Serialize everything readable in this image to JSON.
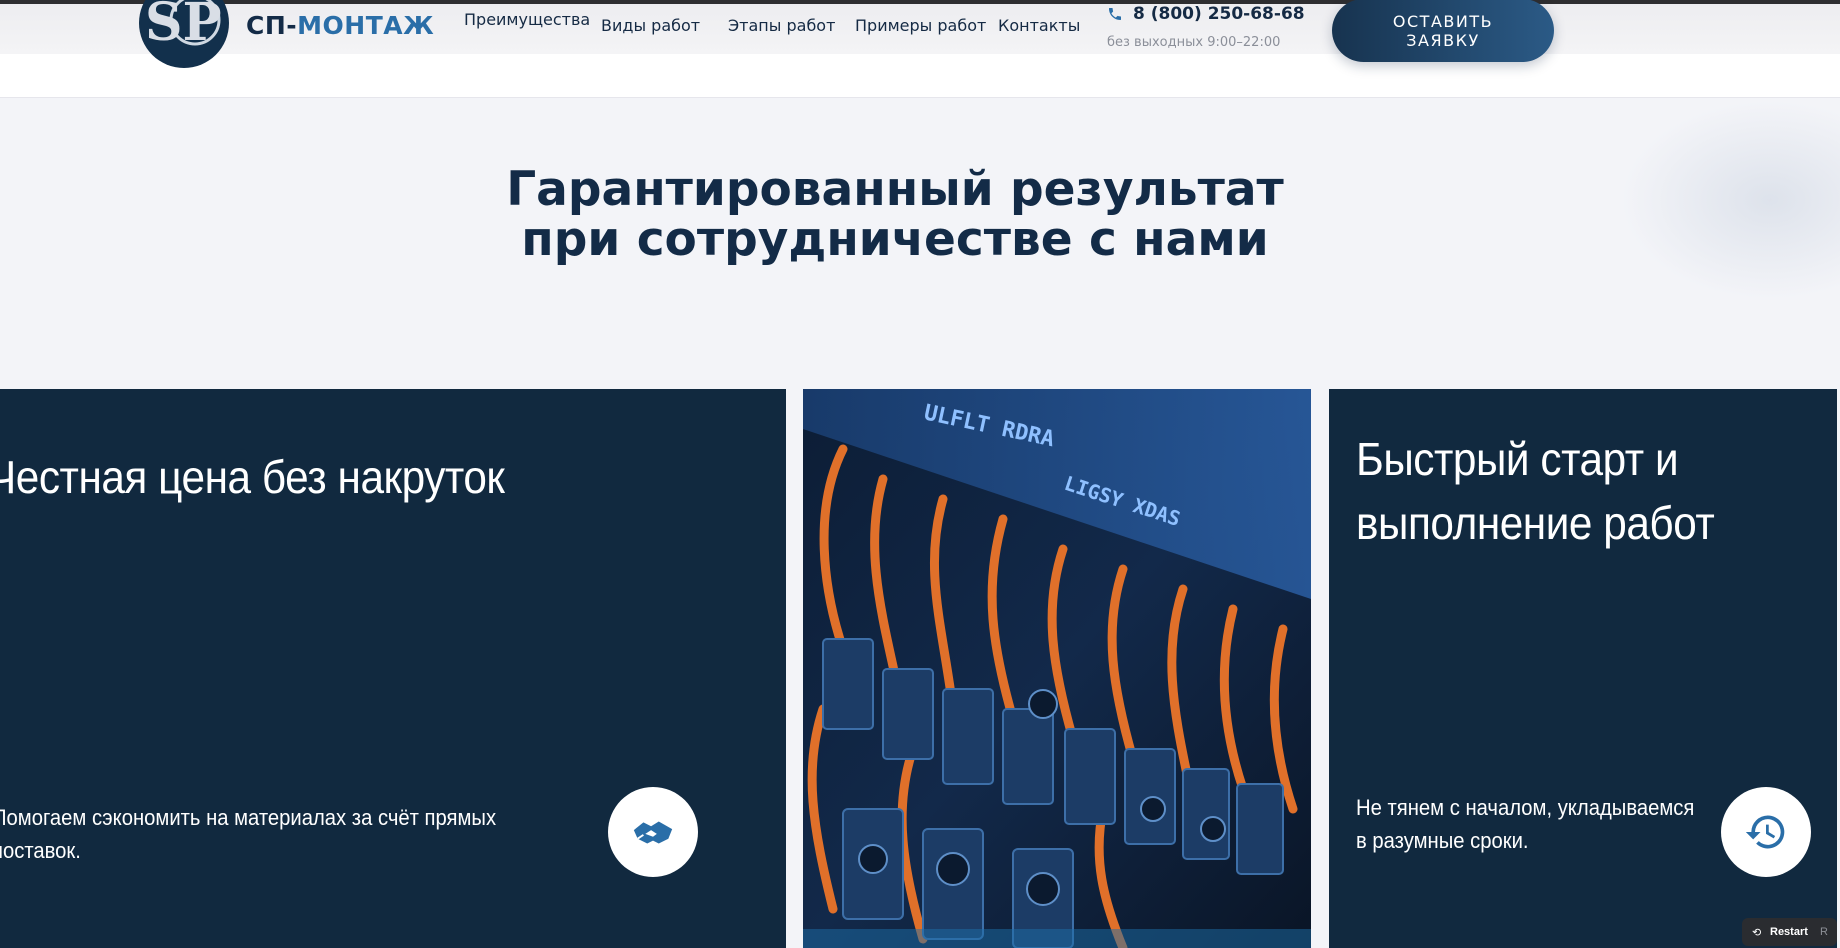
{
  "header": {
    "brand_part1": "СП-",
    "brand_part2": "МОНТАЖ",
    "logo_text": "SP",
    "nav": [
      "Преимущества",
      "Виды работ",
      "Этапы работ",
      "Примеры работ",
      "Контакты"
    ],
    "phone": "8 (800) 250-68-68",
    "hours": "без выходных 9:00–22:00",
    "cta_line1": "ОСТАВИТЬ",
    "cta_line2": "ЗАЯВКУ"
  },
  "section": {
    "title_line1": "Гарантированный результат",
    "title_line2": "при сотрудничестве с нами"
  },
  "cards": [
    {
      "title": "Честная цена без накруток",
      "text_line1": "Помогаем сэкономить на материалах за счёт прямых",
      "text_line2": "поставок.",
      "icon": "handshake-icon"
    },
    {
      "image": "electrical-panel-photo",
      "image_text_line1": "ULFLT RDRA",
      "image_text_line2": "LIGSY XDAS"
    },
    {
      "title_line1": "Быстрый старт и",
      "title_line2": "выполнение работ",
      "text_line1": "Не тянем с началом, укладываемся",
      "text_line2": "в разумные сроки.",
      "icon": "history-clock-icon"
    }
  ],
  "widget": {
    "label": "Restart",
    "key": "R"
  },
  "colors": {
    "navy": "#11293f",
    "accent_blue": "#2a6ea8",
    "page_bg": "#f3f4f8"
  }
}
